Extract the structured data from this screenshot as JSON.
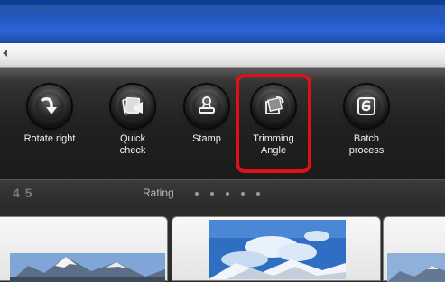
{
  "toolbar": {
    "tools": [
      {
        "id": "rotate-right",
        "label": "Rotate right",
        "icon": "rotate-right-arrow-icon"
      },
      {
        "id": "quick-check",
        "label": "Quick\ncheck",
        "icon": "quick-check-icon"
      },
      {
        "id": "stamp",
        "label": "Stamp",
        "icon": "stamp-icon"
      },
      {
        "id": "trimming-angle",
        "label": "Trimming\nAngle",
        "icon": "trimming-angle-icon",
        "highlighted": true
      },
      {
        "id": "batch-process",
        "label": "Batch\nprocess",
        "icon": "batch-process-icon"
      }
    ],
    "highlight_color": "#e0101a"
  },
  "rating_bar": {
    "numbers": "4 5",
    "label": "Rating"
  },
  "colors": {
    "titlebar": "#1f57c4",
    "toolbar": "#202020",
    "label_text": "#f2f2f2"
  }
}
